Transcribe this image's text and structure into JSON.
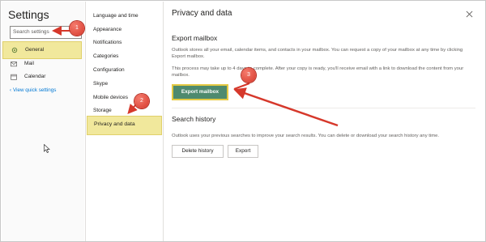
{
  "app": {
    "title": "Settings",
    "search_placeholder": "Search settings"
  },
  "left_nav": {
    "items": [
      {
        "label": "General",
        "icon": "gear-icon"
      },
      {
        "label": "Mail",
        "icon": "mail-icon"
      },
      {
        "label": "Calendar",
        "icon": "calendar-icon"
      }
    ],
    "quick_settings_link": "View quick settings"
  },
  "sub_nav": {
    "items": [
      "Language and time",
      "Appearance",
      "Notifications",
      "Categories",
      "Configuration",
      "Skype",
      "Mobile devices",
      "Storage",
      "Privacy and data"
    ],
    "selected": "Privacy and data"
  },
  "content": {
    "title": "Privacy and data",
    "export_section": {
      "heading": "Export mailbox",
      "description": "Outlook stores all your email, calendar items, and contacts in your mailbox. You can request a copy of your mailbox at any time by clicking Export mailbox.",
      "note": "This process may take up to 4 days to complete. After your copy is ready, you'll receive email with a link to download the content from your mailbox.",
      "button_label": "Export mailbox"
    },
    "search_section": {
      "heading": "Search history",
      "description": "Outlook uses your previous searches to improve your search results. You can delete or download your search history any time.",
      "delete_label": "Delete history",
      "export_label": "Export"
    }
  },
  "callouts": [
    "1",
    "2",
    "3"
  ],
  "colors": {
    "highlight": "#f1e89c",
    "export_button": "#4e8a6e",
    "callout_red": "#d6382b",
    "link_blue": "#0078d4"
  }
}
